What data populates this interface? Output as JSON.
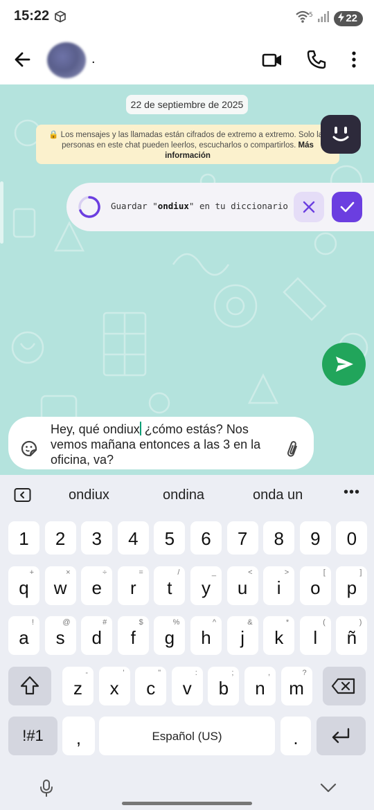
{
  "status_bar": {
    "time": "15:22",
    "battery": "22"
  },
  "header": {
    "contact_name": "."
  },
  "chat": {
    "date_chip": "22 de septiembre de 2025",
    "encryption_notice": "🔒 Los mensajes y las llamadas están cifrados de extremo a extremo. Solo las personas en este chat pueden leerlos, escucharlos o compartirlos.",
    "encryption_link": "Más información"
  },
  "dictionary_banner": {
    "prefix": "Guardar \"",
    "word": "ondiux",
    "suffix": "\" en tu diccionario"
  },
  "composer": {
    "text_before_caret": "Hey, qué ondiux",
    "text_after_caret": " ¿cómo estás? Nos vemos mañana entonces a las 3 en la oficina, va?"
  },
  "keyboard": {
    "suggestions": [
      "ondiux",
      "ondina",
      "onda un"
    ],
    "more": "•••",
    "number_row": [
      "1",
      "2",
      "3",
      "4",
      "5",
      "6",
      "7",
      "8",
      "9",
      "0"
    ],
    "row1": {
      "keys": [
        "q",
        "w",
        "e",
        "r",
        "t",
        "y",
        "u",
        "i",
        "o",
        "p"
      ],
      "hints": [
        "+",
        "×",
        "÷",
        "=",
        "/",
        "_",
        "<",
        ">",
        "[",
        "]"
      ]
    },
    "row2": {
      "keys": [
        "a",
        "s",
        "d",
        "f",
        "g",
        "h",
        "j",
        "k",
        "l",
        "ñ"
      ],
      "hints": [
        "!",
        "@",
        "#",
        "$",
        "%",
        "^",
        "&",
        "*",
        "(",
        ")"
      ]
    },
    "row3": {
      "keys": [
        "z",
        "x",
        "c",
        "v",
        "b",
        "n",
        "m"
      ],
      "hints": [
        "-",
        "'",
        "\"",
        ":",
        ";",
        ",",
        "?"
      ]
    },
    "symbols_label": "!#1",
    "comma_label": ",",
    "space_label": "Español (US)",
    "period_label": "."
  }
}
